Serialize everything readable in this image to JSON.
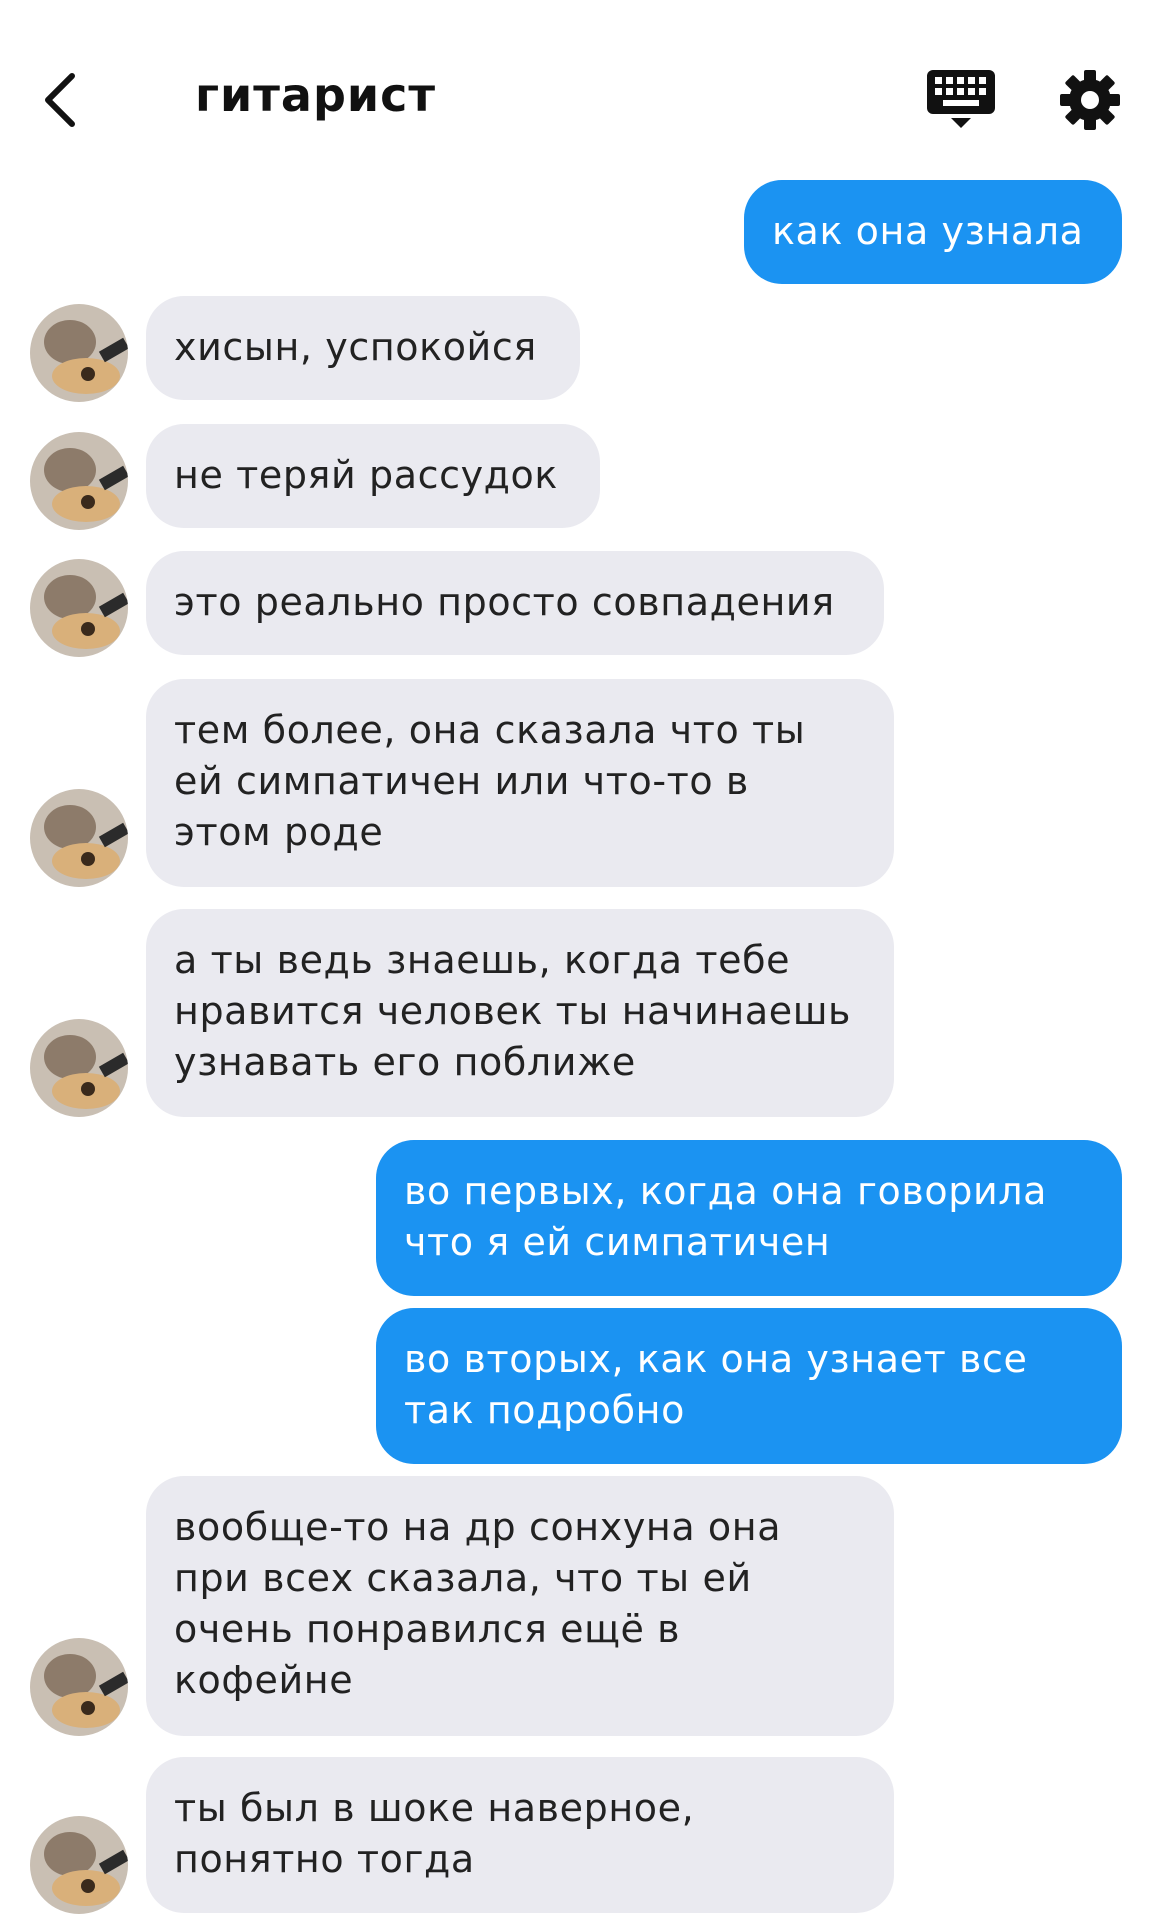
{
  "header": {
    "title": "гитарист"
  },
  "messages": [
    {
      "side": "out",
      "text": "как она узнала"
    },
    {
      "side": "in",
      "text": "хисын, успокойся"
    },
    {
      "side": "in",
      "text": "не теряй рассудок"
    },
    {
      "side": "in",
      "text": "это реально просто совпадения"
    },
    {
      "side": "in",
      "text": "тем более, она сказала что ты\nей симпатичен или что-то в\nэтом роде"
    },
    {
      "side": "in",
      "text": "а ты ведь знаешь, когда тебе\nнравится человек ты начинаешь\nузнавать его поближе"
    },
    {
      "side": "out",
      "text": "во первых, когда она говорила\nчто я ей симпатичен"
    },
    {
      "side": "out",
      "text": "во вторых, как она узнает все\nтак подробно"
    },
    {
      "side": "in",
      "text": "вообще-то на др сонхуна она\nпри всех сказала, что ты ей\nочень понравился ещё в\nкофейне"
    },
    {
      "side": "in",
      "text": "ты был в шоке наверное,\nпонятно тогда"
    }
  ],
  "icons": {
    "back": "chevron-left-icon",
    "keyboard": "keyboard-icon",
    "settings": "gear-icon",
    "avatar": "contact-avatar"
  },
  "colors": {
    "outgoing_bubble": "#1b93f2",
    "incoming_bubble": "#eaeaf0"
  }
}
